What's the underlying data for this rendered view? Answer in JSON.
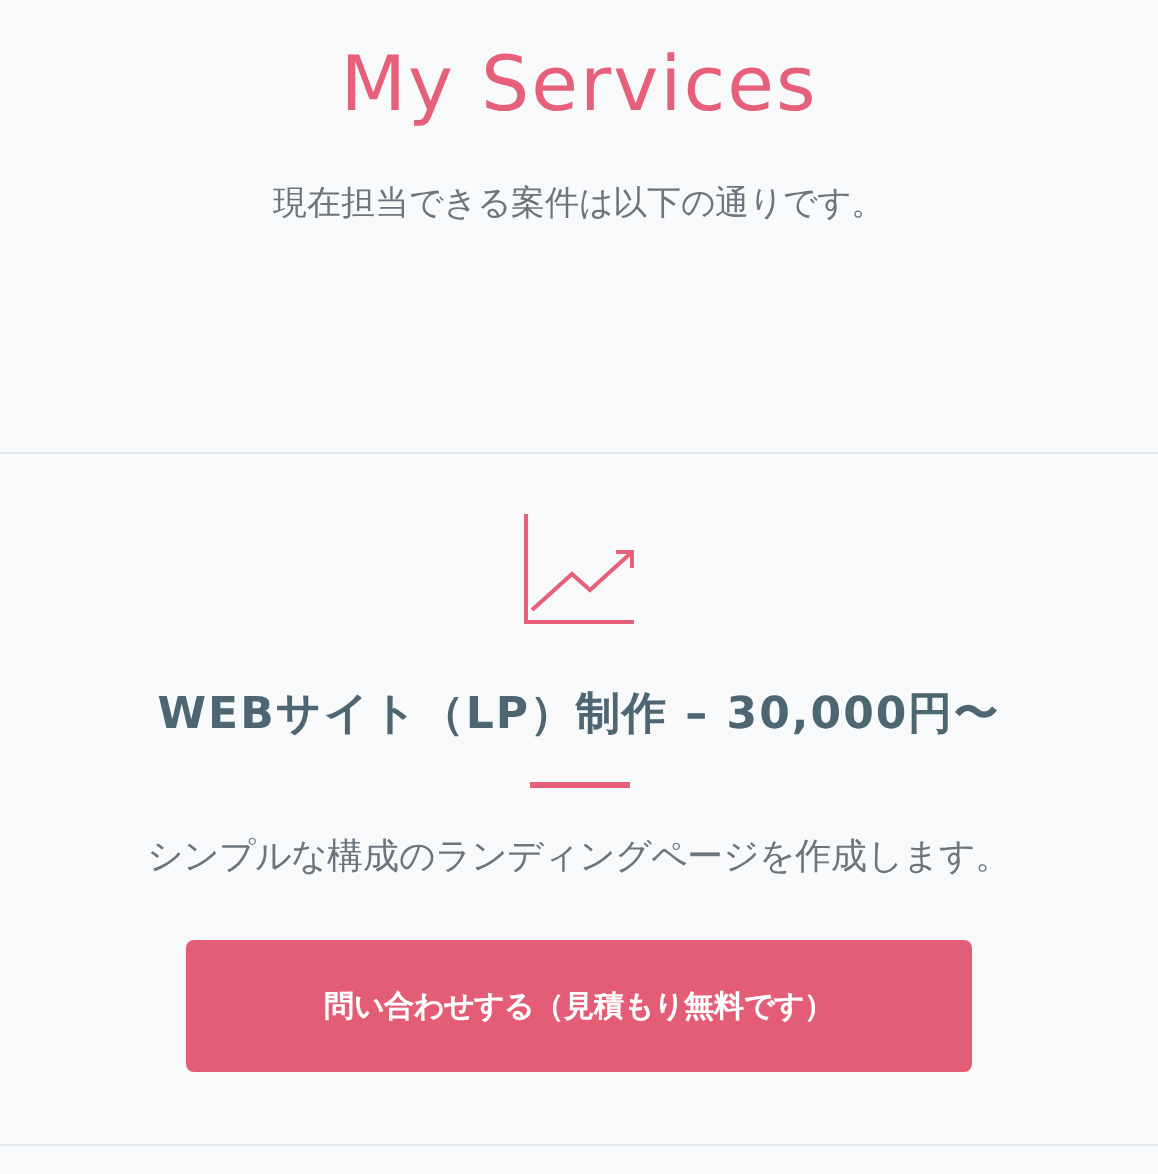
{
  "header": {
    "title": "My Services",
    "subtitle": "現在担当できる案件は以下の通りです。"
  },
  "services": [
    {
      "title": "WEBサイト（LP）制作 – 30,000円〜",
      "description": "シンプルな構成のランディングページを作成します。",
      "button": "問い合わせする（見積もり無料です）"
    }
  ]
}
